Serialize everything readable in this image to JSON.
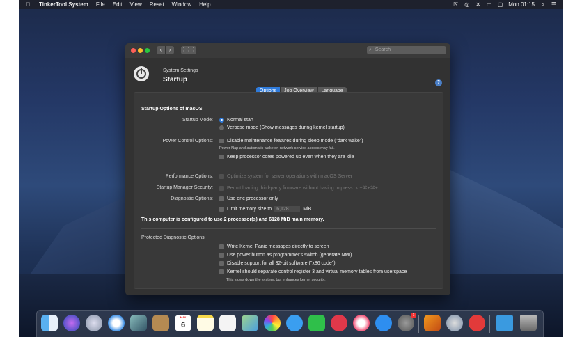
{
  "menubar": {
    "apple_icon": "apple-icon",
    "app_name": "TinkerTool System",
    "items": [
      "File",
      "Edit",
      "View",
      "Reset",
      "Window",
      "Help"
    ],
    "clock": "Mon 01:15"
  },
  "window": {
    "search_placeholder": "Search",
    "subtitle": "System Settings",
    "title": "Startup",
    "help": "?",
    "tabs": [
      "Options",
      "Job Overview",
      "Language"
    ],
    "active_tab": "Options"
  },
  "panel": {
    "section_title": "Startup Options of macOS",
    "startup_mode_label": "Startup Mode:",
    "normal_start": "Normal start",
    "verbose_mode": "Verbose mode (Show messages during kernel startup)",
    "power_label": "Power Control Options:",
    "disable_maintenance": "Disable maintenance features during sleep mode (\"dark wake\")",
    "power_note": "Power Nap and automatic wake on network service access may fail.",
    "keep_cores": "Keep processor cores powered up even when they are idle",
    "performance_label": "Performance Options:",
    "optimize_server": "Optimize system for server operations with macOS Server",
    "security_label": "Startup Manager Security:",
    "permit_firmware": "Permit loading third-party firmware without having to press ⌥+⌘+⌘+.",
    "diagnostic_label": "Diagnostic Options:",
    "one_processor": "Use one processor only",
    "limit_memory": "Limit memory size to",
    "memory_value": "6,128",
    "memory_unit": "MiB",
    "summary": "This computer is configured to use 2 processor(s) and 6128 MiB main memory.",
    "protected_label": "Protected Diagnostic Options:",
    "kernel_panic": "Write Kernel Panic messages directly to screen",
    "power_button": "Use power button as programmer's switch (generate NMI)",
    "disable_32bit": "Disable support for all 32-bit software (\"x86 code\")",
    "separate_cr3": "Kernel should separate control register 3 and virtual memory tables from userspace",
    "cr3_note": "This slows down the system, but enhances kernel security."
  },
  "dock": {
    "calendar_month": "MAY",
    "calendar_day": "6",
    "settings_badge": "1"
  }
}
